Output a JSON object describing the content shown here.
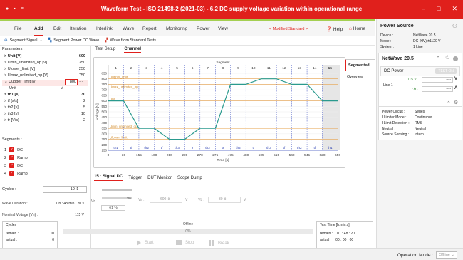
{
  "titlebar": {
    "title": "Waveform Test - ISO 21498-2 (2021-03) - 6.2 DC supply voltage variation within operational range"
  },
  "menu": {
    "items": [
      "File",
      "Add",
      "Edit",
      "Iteration",
      "Interlink",
      "Wave",
      "Report",
      "Monitoring",
      "Power",
      "View"
    ],
    "modified": "< Modified Standard >",
    "help": "Help",
    "home": "Home"
  },
  "toolbar": {
    "segment_signal": "Segment Signal",
    "segment_power_dc": "Segment Power DC Wave",
    "wave_from_standard": "Wave from Standard Tests"
  },
  "params": {
    "header": "Parameters :",
    "rows": [
      {
        "k": "Unit [V]",
        "v": "600"
      },
      {
        "k": "Umin_unlimited_op [V]",
        "v": "350"
      },
      {
        "k": "Ulower_limit [V]",
        "v": "250"
      },
      {
        "k": "Umax_unlimited_op [V]",
        "v": "750"
      },
      {
        "k": "Uupper_limit [V]",
        "v": "800"
      },
      {
        "k": "Unit",
        "v": "V"
      },
      {
        "k": "th1 [s]",
        "v": "30"
      },
      {
        "k": "tf [s/s]",
        "v": "2"
      },
      {
        "k": "th2 [s]",
        "v": "5"
      },
      {
        "k": "th3 [s]",
        "v": "10"
      },
      {
        "k": "tr [V/s]",
        "v": "2"
      }
    ]
  },
  "segments": {
    "title": "Segments :",
    "items": [
      {
        "num": "1",
        "name": "DC"
      },
      {
        "num": "2",
        "name": "Ramp"
      },
      {
        "num": "3",
        "name": "DC"
      },
      {
        "num": "4",
        "name": "Ramp"
      }
    ]
  },
  "cycles": {
    "label": "Cycles :",
    "value": "10"
  },
  "wave_duration": {
    "label": "Wave Duration :",
    "value": "1 h : 48 min : 20 s"
  },
  "nominal_voltage": {
    "label": "Nominal Voltage (Vn) :",
    "value": "115 V"
  },
  "tabs_top": [
    "Test Setup",
    "Channel"
  ],
  "chart_data": {
    "type": "line",
    "xlabel": "Time [s]",
    "ylabel": "Voltage [V]",
    "top_axis_label": "Segment",
    "segments": [
      "1",
      "2",
      "3",
      "4",
      "5",
      "6",
      "7",
      "8",
      "9",
      "10",
      "11",
      "12",
      "13",
      "14",
      "15"
    ],
    "x_ticks": [
      "0",
      "30",
      "155",
      "160",
      "210",
      "220",
      "270",
      "275",
      "475",
      "480",
      "505",
      "515",
      "540",
      "545",
      "620",
      "650"
    ],
    "y_ticks": [
      "150",
      "200",
      "250",
      "300",
      "350",
      "400",
      "450",
      "500",
      "550",
      "600",
      "650",
      "700",
      "750",
      "800",
      "850"
    ],
    "x": [
      0,
      30,
      155,
      160,
      210,
      220,
      270,
      275,
      475,
      480,
      505,
      515,
      540,
      545,
      620,
      650
    ],
    "y": [
      600,
      600,
      350,
      350,
      250,
      250,
      350,
      350,
      750,
      750,
      800,
      800,
      750,
      750,
      600,
      600
    ],
    "ylim": [
      150,
      850
    ],
    "ref_lines": [
      {
        "name": "Uupper_limit",
        "value": 800
      },
      {
        "name": "Umax_unlimited_op",
        "value": 750
      },
      {
        "name": "Unit",
        "value": 600
      },
      {
        "name": "Umin_unlimited_op",
        "value": 350
      },
      {
        "name": "Ulower_limit",
        "value": 250
      }
    ],
    "region_labels": [
      "th1",
      "tf",
      "th2",
      "tf",
      "th3",
      "tr",
      "th2",
      "tr",
      "th2",
      "tr",
      "th3",
      "tf",
      "th2",
      "tf",
      "th1"
    ]
  },
  "side_tabs": [
    "Segmented",
    "Overview"
  ],
  "tabs_bottom": [
    "15 : Signal DC",
    "Trigger",
    "DUT Monitor",
    "Scope Dump"
  ],
  "signal_dc": {
    "vn": "Vn",
    "pct": "61 %",
    "va": "Va :",
    "va_val": "600",
    "vl": "VL :",
    "vl_val": "30",
    "unit": "V"
  },
  "status": {
    "cycles_title": "Cycles",
    "remain_label": "remain :",
    "remain_val": "10",
    "actual_label": "actual :",
    "actual_val": "0",
    "offline": "Offline",
    "progress": "0%",
    "start": "Start",
    "stop": "Stop",
    "break": "Break",
    "test_time_title": "Test Time [h:min:s]",
    "tt_remain": "01 : 48 : 20",
    "tt_actual": "00 : 00 : 00"
  },
  "power_source": {
    "title": "Power Source",
    "device_k": "Device :",
    "device_v": "NetWave 20.5",
    "mode_k": "Mode :",
    "mode_v": "DC (HV) ±1120 V",
    "system_k": "System :",
    "system_v": "1 Line",
    "nw_title": "NetWave 20.5",
    "dc_power": "DC Power",
    "test_on": "TEST ON",
    "line1": "Line 1",
    "v_val": "115 V",
    "a_val": "- A :",
    "v_unit": "V",
    "a_unit": "A",
    "dash": "----",
    "circuit_k": "Power Circuit :",
    "circuit_v": "Series",
    "limiter_k": "I Limiter Mode :",
    "limiter_v": "Continuous",
    "limdet_k": "I Limit Detection :",
    "limdet_v": "RMS",
    "neutral_k": "Neutral :",
    "neutral_v": "Neutral",
    "sense_k": "Source Sensing :",
    "sense_v": "Intern"
  },
  "statusbar": {
    "label": "Operation Mode :",
    "value": "Offline"
  }
}
